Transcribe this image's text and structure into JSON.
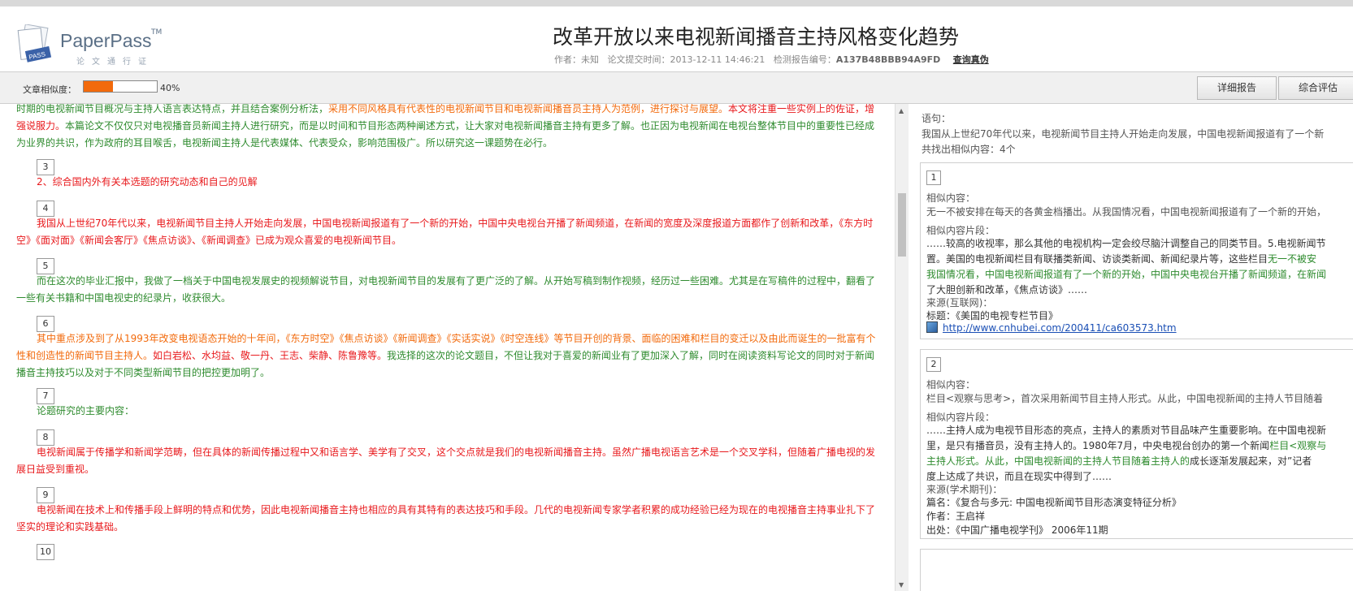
{
  "header": {
    "brand": "PaperPass",
    "tm": "TM",
    "tagline": "论文通行证",
    "title": "改革开放以来电视新闻播音主持风格变化趋势",
    "meta_author": "作者：未知",
    "meta_time": "论文提交时间：2013-12-11 14:46:21",
    "meta_id_label": "检测报告编号：",
    "meta_id": "A137B48BBB94A9FD",
    "verify": "查询真伪"
  },
  "similarity": {
    "label": "文章相似度：",
    "percent_text": "40%",
    "fill_fraction": 0.4
  },
  "toolbar": {
    "detail_label": "详细报告",
    "overall_label": "综合评估"
  },
  "left": {
    "p0": {
      "a": "时期的电视新闻节目概况与主持人语言表达特点，并且结合案例分析法，",
      "b": "采用不同风格具有代表性的电视新闻节目和电视新闻播音员主持人为范例，进行探讨与展望。",
      "c": "本文将注重一些实例上的佐证，增强说服力。",
      "d": "本篇论文不仅仅只对电视播音员新闻主持人进行研究，而是以时间和节目形态两种阐述方式，让大家对电视新闻播音主持有更多了解。也正因为电视新闻在电视台整体节目中的重要性已经成为业界的共识，作为政府的耳目喉舌，电视新闻主持人是代表媒体、代表受众，影响范围极广。所以研究这一课题势在必行。"
    },
    "n3": "3",
    "p3": "2、综合国内外有关本选题的研究动态和自己的见解",
    "n4": "4",
    "p4": "我国从上世纪70年代以来，电视新闻节目主持人开始走向发展，中国电视新闻报道有了一个新的开始，中国中央电视台开播了新闻频道，在新闻的宽度及深度报道方面都作了创新和改革，《东方时空》《面对面》《新闻会客厅》《焦点访谈》、《新闻调查》已成为观众喜爱的电视新闻节目。",
    "n5": "5",
    "p5": "而在这次的毕业汇报中，我做了一档关于中国电视发展史的视频解说节目，对电视新闻节目的发展有了更广泛的了解。从开始写稿到制作视频，经历过一些困难。尤其是在写稿件的过程中，翻看了一些有关书籍和中国电视史的纪录片，收获很大。",
    "n6": "6",
    "p6": {
      "a": "其中重点涉及到了从1993年改变电视语态开始的十年间，《东方时空》《焦点访谈》《新闻调查》《实话实说》《时空连线》等节目开创的背景、面临的困难和栏目的变迁以及由此而诞生的一批富有个性和创造性的新闻节目主持人。",
      "b": "如白岩松、水均益、敬一丹、王志、柴静、陈鲁豫等。",
      "c": "我选择的这次的论文题目，不但让我对于喜爱的新闻业有了更加深入了解，同时在阅读资料写论文的同时对于新闻播音主持技巧以及对于不同类型新闻节目的把控更加明了。"
    },
    "n7": "7",
    "p7": "论题研究的主要内容：",
    "n8": "8",
    "p8": "电视新闻属于传播学和新闻学范畴，但在具体的新闻传播过程中又和语言学、美学有了交叉，这个交点就是我们的电视新闻播音主持。虽然广播电视语言艺术是一个交叉学科，但随着广播电视的发展日益受到重视。",
    "n9": "9",
    "p9": "电视新闻在技术上和传播手段上鲜明的特点和优势，因此电视新闻播音主持也相应的具有其特有的表达技巧和手段。几代的电视新闻专家学者积累的成功经验已经为现在的电视播音主持事业扎下了坚实的理论和实践基础。",
    "n10": "10"
  },
  "right": {
    "sentence_label": "语句：",
    "sentence": "我国从上世纪70年代以来，电视新闻节目主持人开始走向发展，中国电视新闻报道有了一个新",
    "found": "共找出相似内容：4个",
    "card1": {
      "num": "1",
      "sim_label": "相似内容：",
      "sim": "无一不被安排在每天的各黄金档播出。从我国情况看，中国电视新闻报道有了一个新的开始，",
      "frag_label": "相似内容片段：",
      "frag_l1": "……较高的收视率，那么其他的电视机构一定会绞尽脑汁调整自己的同类节目。5.电视新闻节",
      "frag_l2": "置。美国的电视新闻栏目有联播类新闻、访谈类新闻、新闻纪录片等，这些栏目",
      "frag_l2b": "无一不被安",
      "frag_l3": "我国情况看，中国电视新闻报道有了一个新的开始，",
      "frag_l3b": "中国中央电视台开播了新闻频道，在新闻",
      "frag_l4": "了大胆创新和改革，《焦点访谈》……",
      "src_label": "来源(互联网)：",
      "title": "标题：《美国的电视专栏节目》",
      "url": "http://www.cnhubei.com/200411/ca603573.htm"
    },
    "card2": {
      "num": "2",
      "sim_label": "相似内容：",
      "sim": "栏目<观察与思考>，首次采用新闻节目主持人形式。从此，中国电视新闻的主持人节目随着",
      "frag_label": "相似内容片段：",
      "frag_l1": "……主持人成为电视节目形态的亮点，主持人的素质对节目品味产生重要影响。在中国电视新",
      "frag_l2": "里，是只有播音员，没有主持人的。1980年7月，中央电视台创办的第一个新闻",
      "frag_l2b": "栏目<观察与",
      "frag_l3": "主持人形式。从此，中国电视新闻的主持人节目随着主持人的",
      "frag_l3b": "成长逐渐发展起来，对”记者",
      "frag_l4": "度上达成了共识，而且在现实中得到了……",
      "src_label": "来源(学术期刊)：",
      "title": "篇名：《复合与多元: 中国电视新闻节目形态演变特征分析》",
      "author": "作者：王启祥",
      "pub": "出处：《中国广播电视学刊》 2006年11期"
    }
  }
}
